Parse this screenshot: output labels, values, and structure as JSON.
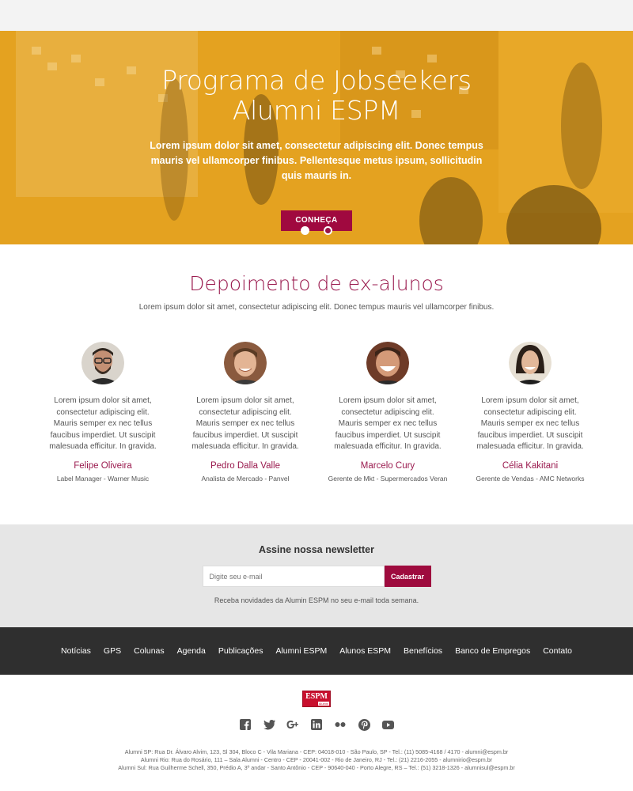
{
  "hero": {
    "title_line1": "Programa de Jobseekers",
    "title_line2": "Alumni ESPM",
    "subtitle": "Lorem ipsum dolor sit amet, consectetur adipiscing elit. Donec tempus mauris vel ullamcorper finibus. Pellentesque metus ipsum, sollicitudin quis mauris in.",
    "cta_label": "CONHEÇA",
    "slide_count": 2,
    "active_slide": 1
  },
  "testimonials": {
    "title": "Depoimento de ex-alunos",
    "subtitle": "Lorem ipsum dolor sit amet, consectetur adipiscing elit. Donec tempus mauris vel ullamcorper finibus.",
    "people": [
      {
        "name": "Felipe Oliveira",
        "role": "Label Manager - Warner Music",
        "quote": "Lorem ipsum dolor sit amet, consectetur adipiscing elit. Mauris semper ex nec tellus faucibus imperdiet. Ut suscipit malesuada efficitur. In gravida."
      },
      {
        "name": "Pedro Dalla Valle",
        "role": "Analista de Mercado - Panvel",
        "quote": "Lorem ipsum dolor sit amet, consectetur adipiscing elit. Mauris semper ex nec tellus faucibus imperdiet. Ut suscipit malesuada efficitur. In gravida."
      },
      {
        "name": "Marcelo Cury",
        "role": "Gerente de Mkt - Supermercados Veran",
        "quote": "Lorem ipsum dolor sit amet, consectetur adipiscing elit. Mauris semper ex nec tellus faucibus imperdiet. Ut suscipit malesuada efficitur. In gravida."
      },
      {
        "name": "Célia Kakitani",
        "role": "Gerente de Vendas - AMC Networks",
        "quote": "Lorem ipsum dolor sit amet, consectetur adipiscing elit. Mauris semper ex nec tellus faucibus imperdiet. Ut suscipit malesuada efficitur. In gravida."
      }
    ]
  },
  "newsletter": {
    "title": "Assine nossa newsletter",
    "placeholder": "Digite seu e-mail",
    "button_label": "Cadastrar",
    "note": "Receba novidades da Alumin ESPM no seu e-mail toda semana."
  },
  "nav": [
    "Notícias",
    "GPS",
    "Colunas",
    "Agenda",
    "Publicações",
    "Alumni ESPM",
    "Alunos ESPM",
    "Benefícios",
    "Banco de Empregos",
    "Contato"
  ],
  "footer": {
    "logo_text": "ESPM",
    "logo_sub": "Alumni",
    "socials": [
      "facebook-icon",
      "twitter-icon",
      "google-plus-icon",
      "linkedin-icon",
      "flickr-icon",
      "pinterest-icon",
      "youtube-icon"
    ],
    "addresses": [
      "Alumni SP: Rua Dr. Álvaro Alvim, 123, Sl 304, Bloco C - Vila Mariana - CEP: 04018-010 - São Paulo, SP - Tel.: (11) 5085-4168 / 4170 - alumni@espm.br",
      "Alumni Rio: Rua do Rosário, 111 – Sala Alumni - Centro - CEP - 20041-002 - Rio de Janeiro, RJ - Tel.: (21) 2216-2055 - alumnirio@espm.br",
      "Alumni Sul: Rua Guilherme Schell, 350, Prédio A, 3º andar - Santo Antônio - CEP - 90640-040 - Porto Alegre, RS – Tel.: (51) 3218-1326 - alumnisul@espm.br"
    ]
  },
  "colors": {
    "accent": "#9a1a4e",
    "button": "#a0093f",
    "hero_tint": "#e8a823",
    "nav_bg": "#2f2f2f",
    "newsletter_bg": "#e6e6e6"
  }
}
